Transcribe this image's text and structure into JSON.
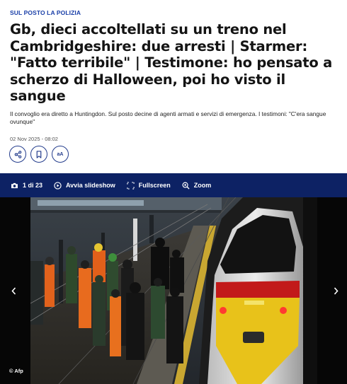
{
  "article": {
    "kicker": "SUL POSTO LA POLIZIA",
    "headline": "Gb, dieci accoltellati su un treno nel Cambridgeshire: due arresti | Starmer: \"Fatto terribile\" | Testimone: ho pensato a scherzo di Halloween, poi ho visto il sangue",
    "subtitle": "Il convoglio era diretto a Huntingdon. Sul posto decine di agenti armati e servizi di emergenza. I testimoni: \"C'era sangue ovunque\"",
    "date": "02 Nov 2025 - 08:02"
  },
  "actions": {
    "share_icon": "share-icon",
    "bookmark_icon": "bookmark-icon",
    "font_size_label": "aA"
  },
  "gallery": {
    "counter": "1 di 23",
    "slideshow_label": "Avvia slideshow",
    "fullscreen_label": "Fullscreen",
    "zoom_label": "Zoom",
    "credit": "© Afp",
    "bar_color": "#0d2264",
    "accent_color": "#1a3fa8"
  }
}
